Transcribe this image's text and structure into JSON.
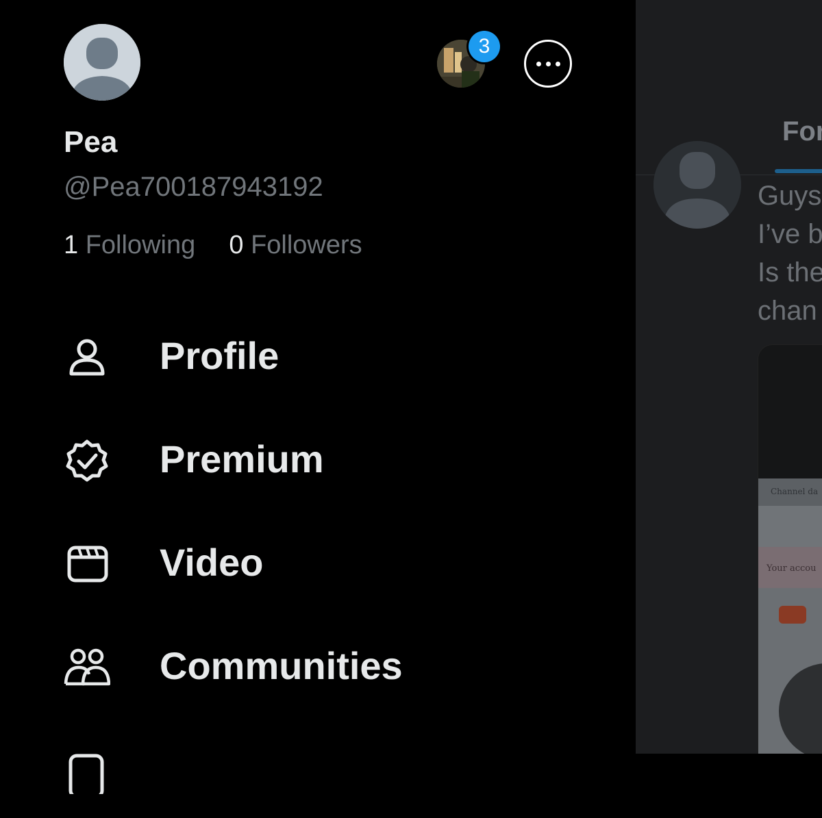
{
  "feed": {
    "tab_label": "For",
    "post_lines": [
      "Guys",
      "I’ve b",
      "Is the",
      "chan"
    ],
    "media_tab_text": "Channel da",
    "media_notice_text": "Your accou"
  },
  "drawer": {
    "display_name": "Pea",
    "handle": "@Pea700187943192",
    "following_count": "1",
    "following_label": "Following",
    "followers_count": "0",
    "followers_label": "Followers",
    "account_badge_count": "3",
    "menu": [
      {
        "label": "Profile",
        "icon": "person-icon"
      },
      {
        "label": "Premium",
        "icon": "verified-badge-icon"
      },
      {
        "label": "Video",
        "icon": "video-icon"
      },
      {
        "label": "Communities",
        "icon": "communities-icon"
      }
    ]
  },
  "colors": {
    "background": "#000000",
    "primary_text": "#e7e9ea",
    "secondary_text": "#71767b",
    "badge": "#1d9bf0"
  }
}
